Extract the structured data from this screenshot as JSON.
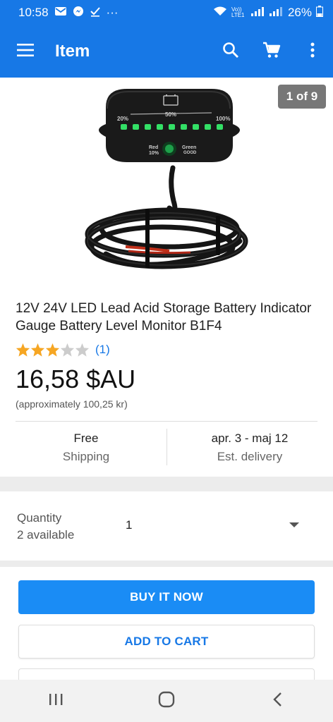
{
  "status": {
    "time": "10:58",
    "ellipsis": "···",
    "volte": "Vo)) LTE1",
    "battery": "26%"
  },
  "app_bar": {
    "title": "Item"
  },
  "product": {
    "image_counter": "1 of 9",
    "image_labels": {
      "pct20": "20%",
      "pct50": "50%",
      "pct100": "100%",
      "red": "Red",
      "red_pct": "10%",
      "green": "Green",
      "good": "GOOD"
    },
    "title": "12V 24V LED Lead Acid Storage Battery Indicator Gauge Battery Level Monitor B1F4",
    "rating_value": 3,
    "rating_max": 5,
    "rating_count": "(1)",
    "price": "16,58 $AU",
    "approx_price": "(approximately 100,25 kr)",
    "shipping": {
      "value": "Free",
      "label": "Shipping"
    },
    "delivery": {
      "value": "apr. 3 - maj 12",
      "label": "Est. delivery"
    }
  },
  "quantity": {
    "label": "Quantity",
    "available": "2 available",
    "value": "1"
  },
  "buttons": {
    "buy_now": "BUY IT NOW",
    "add_to_cart": "ADD TO CART"
  },
  "colors": {
    "brand_blue": "#1778e6",
    "buy_button": "#1a8cf5",
    "star_filled": "#f6a623",
    "star_empty": "#cccccc"
  }
}
